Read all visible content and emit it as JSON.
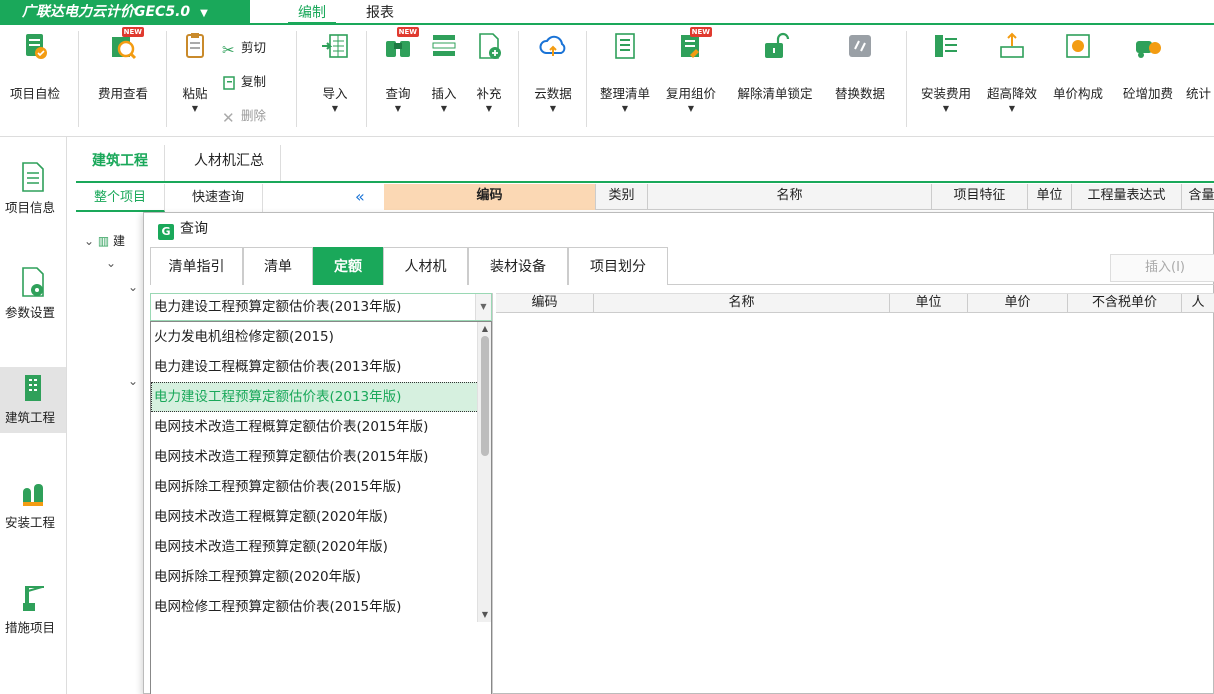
{
  "app": {
    "title": "广联达电力云计价GEC5.0",
    "menu_tabs": [
      "编制",
      "报表"
    ]
  },
  "ribbon": {
    "project_check": "项目自检",
    "fee_view": "费用查看",
    "paste": "粘贴",
    "cut": "剪切",
    "copy": "复制",
    "delete": "删除",
    "import": "导入",
    "query": "查询",
    "insert": "插入",
    "supplement": "补充",
    "cloud_data": "云数据",
    "organize_list": "整理清单",
    "reuse_group": "复用组价",
    "unlock_list": "解除清单锁定",
    "replace_data": "替换数据",
    "install_fee": "安装费用",
    "height_reduce": "超高降效",
    "unit_price": "单价构成",
    "concrete_add": "砼增加费",
    "stats": "统计",
    "new_badge": "NEW"
  },
  "sidebar": [
    {
      "label": "项目信息"
    },
    {
      "label": "参数设置"
    },
    {
      "label": "建筑工程"
    },
    {
      "label": "安装工程"
    },
    {
      "label": "措施项目"
    }
  ],
  "main": {
    "tabs": [
      "建筑工程",
      "人材机汇总"
    ],
    "subtabs": [
      "整个项目",
      "快速查询"
    ],
    "columns": [
      "编码",
      "类别",
      "名称",
      "项目特征",
      "单位",
      "工程量表达式",
      "含量"
    ],
    "tree_label": "建"
  },
  "dialog": {
    "title": "查询",
    "logo": "G",
    "tabs": [
      "清单指引",
      "清单",
      "定额",
      "人材机",
      "装材设备",
      "项目划分"
    ],
    "insert_button": "插入(I)",
    "selected_value": "电力建设工程预算定额估价表(2013年版)",
    "options": [
      "火力发电机组检修定额(2015)",
      "电力建设工程概算定额估价表(2013年版)",
      "电力建设工程预算定额估价表(2013年版)",
      "电网技术改造工程概算定额估价表(2015年版)",
      "电网技术改造工程预算定额估价表(2015年版)",
      "电网拆除工程预算定额估价表(2015年版)",
      "电网技术改造工程概算定额(2020年版)",
      "电网技术改造工程预算定额(2020年版)",
      "电网拆除工程预算定额(2020年版)",
      "电网检修工程预算定额估价表(2015年版)"
    ],
    "columns": [
      "编码",
      "名称",
      "单位",
      "单价",
      "不含税单价",
      "人"
    ]
  },
  "colors": {
    "accent": "#1aa85a",
    "new_badge": "#e03a2f",
    "code_header": "#fbd8b4"
  }
}
